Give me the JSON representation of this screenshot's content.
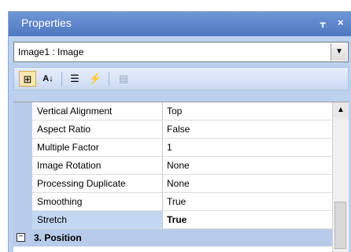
{
  "window": {
    "title": "Properties",
    "pin_glyph": "ȣ",
    "close_glyph": "×"
  },
  "object_selector": {
    "value": "Image1 : Image",
    "dropdown_glyph": "▼"
  },
  "toolbar": {
    "items": [
      {
        "name": "categorized",
        "glyph": "⊞",
        "active": true
      },
      {
        "name": "alphabetical",
        "glyph": "A↓",
        "active": false
      },
      {
        "name": "properties",
        "glyph": "☰",
        "active": false
      },
      {
        "name": "events",
        "glyph": "⚡",
        "active": false
      },
      {
        "name": "property-pages",
        "glyph": "▤",
        "active": false
      }
    ]
  },
  "grid": {
    "rows": [
      {
        "name": "Vertical Alignment",
        "value": "Top"
      },
      {
        "name": "Aspect Ratio",
        "value": "False"
      },
      {
        "name": "Multiple Factor",
        "value": "1"
      },
      {
        "name": "Image Rotation",
        "value": "None"
      },
      {
        "name": "Processing Duplicate",
        "value": "None"
      },
      {
        "name": "Smoothing",
        "value": "True"
      },
      {
        "name": "Stretch",
        "value": "True",
        "selected": true
      }
    ],
    "category": {
      "expander": "⊟",
      "label": "3. Position"
    },
    "scroll_up_glyph": "▲"
  }
}
